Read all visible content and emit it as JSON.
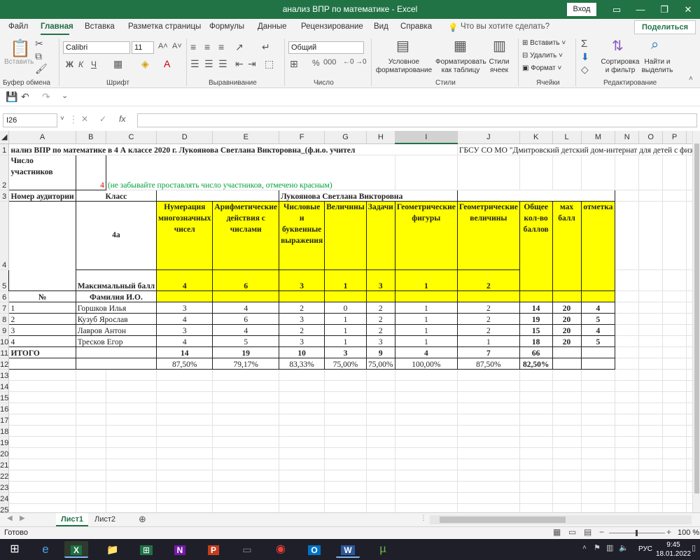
{
  "window": {
    "title": "анализ  ВПР по математике  -  Excel",
    "login": "Вход"
  },
  "menu": {
    "tabs": [
      "Файл",
      "Главная",
      "Вставка",
      "Разметка страницы",
      "Формулы",
      "Данные",
      "Рецензирование",
      "Вид",
      "Справка"
    ],
    "tell_me": "Что вы хотите сделать?",
    "share": "Поделиться"
  },
  "ribbon": {
    "paste": "Вставить",
    "clipboard": "Буфер обмена",
    "font_group": "Шрифт",
    "align_group": "Выравнивание",
    "number_group": "Число",
    "styles_group": "Стили",
    "cells_group": "Ячейки",
    "edit_group": "Редактирование",
    "font_name": "Calibri",
    "font_size": "11",
    "number_format": "Общий",
    "cond_fmt_1": "Условное",
    "cond_fmt_2": "форматирование",
    "fmt_table_1": "Форматировать",
    "fmt_table_2": "как таблицу",
    "cell_styles_1": "Стили",
    "cell_styles_2": "ячеек",
    "insert": "Вставить",
    "delete": "Удалить",
    "format": "Формат",
    "sort_1": "Сортировка",
    "sort_2": "и фильтр",
    "find_1": "Найти и",
    "find_2": "выделить"
  },
  "formula_bar": {
    "name_box": "I26",
    "formula": ""
  },
  "columns": [
    "A",
    "B",
    "C",
    "D",
    "E",
    "F",
    "G",
    "H",
    "I",
    "J",
    "K",
    "L",
    "M",
    "N",
    "O",
    "P",
    "Q",
    "R"
  ],
  "sheet": {
    "r1": "нализ ВПР по математике в 4 А классе 2020 г. Лукоянова Светлана Викторовна_(ф.и.о. учител",
    "r1_j": "ГБСУ СО МО \"Дмитровский детский дом-интернат для детей с физическими н",
    "r2_a": "Число участников",
    "r2_b": "4",
    "r2_c": "(не забывайте проставлять число участников, отмечено красным)",
    "r3_a": "Номер аудитории",
    "r3_c": "Класс",
    "r3_f": "Лукоянова Светлана Викторовна",
    "r4_c": "4а",
    "h_d": "Нумерация многозначных чисел",
    "h_e": "Арифметические действия с числами",
    "h_f": "Числовые и буквенные выражения",
    "h_g": "Величины",
    "h_h": "Задачи",
    "h_i": "Геометрические фигуры",
    "h_j": "Геометрические величины",
    "h_k": "Общее кол-во баллов",
    "h_l": "мах балл",
    "h_m": "отметка",
    "r5_c": "Максимальный  балл",
    "r5": [
      "4",
      "6",
      "3",
      "1",
      "3",
      "1",
      "2"
    ],
    "r6_a": "№",
    "r6_c": "Фамилия И.О.",
    "students": [
      {
        "n": "1",
        "name": "Горшков Илья",
        "s": [
          "3",
          "4",
          "2",
          "0",
          "2",
          "1",
          "2"
        ],
        "total": "14",
        "max": "20",
        "mark": "4"
      },
      {
        "n": "2",
        "name": "Кузуб Ярослав",
        "s": [
          "4",
          "6",
          "3",
          "1",
          "2",
          "1",
          "2"
        ],
        "total": "19",
        "max": "20",
        "mark": "5"
      },
      {
        "n": "3",
        "name": "Лавров Антон",
        "s": [
          "3",
          "4",
          "2",
          "1",
          "2",
          "1",
          "2"
        ],
        "total": "15",
        "max": "20",
        "mark": "4"
      },
      {
        "n": "4",
        "name": "Тресков Егор",
        "s": [
          "4",
          "5",
          "3",
          "1",
          "3",
          "1",
          "1"
        ],
        "total": "18",
        "max": "20",
        "mark": "5"
      }
    ],
    "r11_a": "ИТОГО",
    "r11": [
      "14",
      "19",
      "10",
      "3",
      "9",
      "4",
      "7"
    ],
    "r11_k": "66",
    "r12": [
      "87,50%",
      "79,17%",
      "83,33%",
      "75,00%",
      "75,00%",
      "100,00%",
      "87,50%"
    ],
    "r12_k": "82,50%"
  },
  "sheets": [
    "Лист1",
    "Лист2"
  ],
  "status": {
    "ready": "Готово",
    "zoom": "100 %"
  },
  "taskbar": {
    "lang": "РУС",
    "time": "9:45",
    "date": "18.01.2022"
  }
}
